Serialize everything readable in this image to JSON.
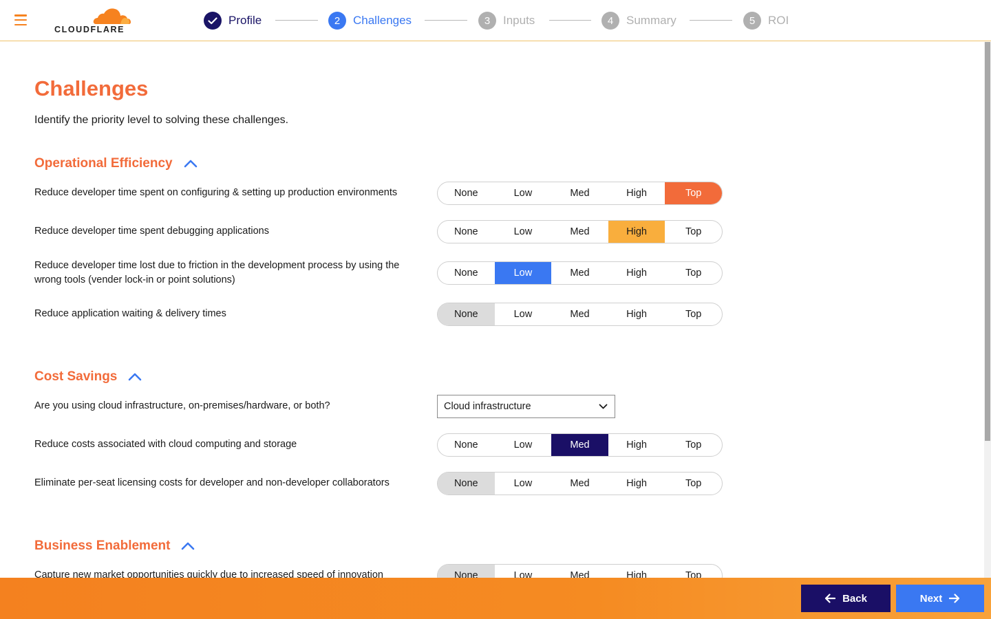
{
  "brand": {
    "name": "CLOUDFLARE",
    "accent": "#f26b3a",
    "orange": "#f6821f",
    "navy": "#1a0f66",
    "blue": "#3a78f2"
  },
  "steps": [
    {
      "number": "1",
      "label": "Profile",
      "state": "done"
    },
    {
      "number": "2",
      "label": "Challenges",
      "state": "active"
    },
    {
      "number": "3",
      "label": "Inputs",
      "state": "todo"
    },
    {
      "number": "4",
      "label": "Summary",
      "state": "todo"
    },
    {
      "number": "5",
      "label": "ROI",
      "state": "todo"
    }
  ],
  "page": {
    "title": "Challenges",
    "subtitle": "Identify the priority level to solving these challenges."
  },
  "levels": [
    "None",
    "Low",
    "Med",
    "High",
    "Top"
  ],
  "sections": {
    "operational": {
      "title": "Operational Efficiency",
      "questions": [
        {
          "label": "Reduce developer time spent on configuring & setting up production environments",
          "selected": "Top"
        },
        {
          "label": "Reduce developer time spent debugging applications",
          "selected": "High"
        },
        {
          "label": "Reduce developer time lost due to friction in the development process by using the wrong tools (vender lock-in or point solutions)",
          "selected": "Low"
        },
        {
          "label": "Reduce application waiting & delivery times",
          "selected": "None"
        }
      ]
    },
    "cost": {
      "title": "Cost Savings",
      "infra_question": "Are you using cloud infrastructure, on-premises/hardware, or both?",
      "infra_value": "Cloud infrastructure",
      "questions": [
        {
          "label": "Reduce costs associated with cloud computing and storage",
          "selected": "Med"
        },
        {
          "label": "Eliminate per-seat licensing costs for developer and non-developer collaborators",
          "selected": "None"
        }
      ]
    },
    "business": {
      "title": "Business Enablement",
      "questions": [
        {
          "label": "Capture new market opportunities quickly due to increased speed of innovation",
          "selected": "None"
        }
      ]
    }
  },
  "footer": {
    "back_label": "Back",
    "next_label": "Next"
  }
}
